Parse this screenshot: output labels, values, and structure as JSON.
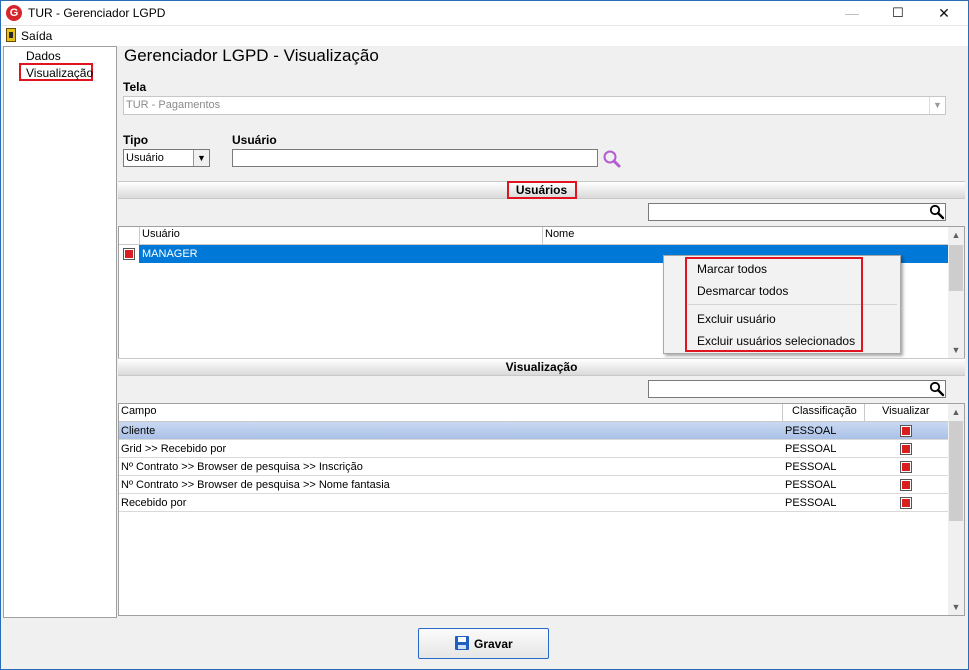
{
  "window": {
    "title": "TUR - Gerenciador LGPD",
    "logo_letter": "G",
    "minimize_glyph": "—",
    "maximize_glyph": "☐",
    "close_glyph": "✕"
  },
  "menu": {
    "exit_label": "Saída",
    "exit_underline_char": "S"
  },
  "tree": {
    "items": [
      {
        "label": "Dados"
      },
      {
        "label": "Visualização",
        "selected": true
      }
    ]
  },
  "page": {
    "title": "Gerenciador LGPD - Visualização"
  },
  "tela": {
    "label": "Tela",
    "value": "TUR - Pagamentos"
  },
  "tipo": {
    "label": "Tipo",
    "value": "Usuário"
  },
  "usuario": {
    "label": "Usuário",
    "value": ""
  },
  "usuarios_section": {
    "title": "Usuários",
    "columns": [
      "Usuário",
      "Nome"
    ],
    "rows": [
      {
        "checked": true,
        "usuario": "MANAGER",
        "nome": ""
      }
    ]
  },
  "context_menu": {
    "items": [
      "Marcar todos",
      "Desmarcar todos",
      "Excluir usuário",
      "Excluir usuários selecionados"
    ]
  },
  "visualizacao_section": {
    "title": "Visualização",
    "columns": [
      "Campo",
      "Classificação",
      "Visualizar"
    ],
    "rows": [
      {
        "campo": "Cliente",
        "classificacao": "PESSOAL",
        "visualizar": true,
        "selected": true
      },
      {
        "campo": "Grid >> Recebido por",
        "classificacao": "PESSOAL",
        "visualizar": true
      },
      {
        "campo": "Nº Contrato >> Browser de pesquisa >> Inscrição",
        "classificacao": "PESSOAL",
        "visualizar": true
      },
      {
        "campo": "Nº Contrato >> Browser de pesquisa >> Nome fantasia",
        "classificacao": "PESSOAL",
        "visualizar": true
      },
      {
        "campo": "Recebido por",
        "classificacao": "PESSOAL",
        "visualizar": true
      }
    ]
  },
  "footer": {
    "save_label": "Gravar"
  },
  "colors": {
    "selection": "#0078d7",
    "selected_row_light": "#b7cbe9",
    "highlight_box": "#e0141e",
    "checkbox_mark": "#d81e1e"
  },
  "icons": [
    "app-logo-icon",
    "exit-door-icon",
    "search-icon",
    "dropdown-arrow-icon",
    "scroll-up-icon",
    "scroll-down-icon",
    "floppy-save-icon"
  ]
}
